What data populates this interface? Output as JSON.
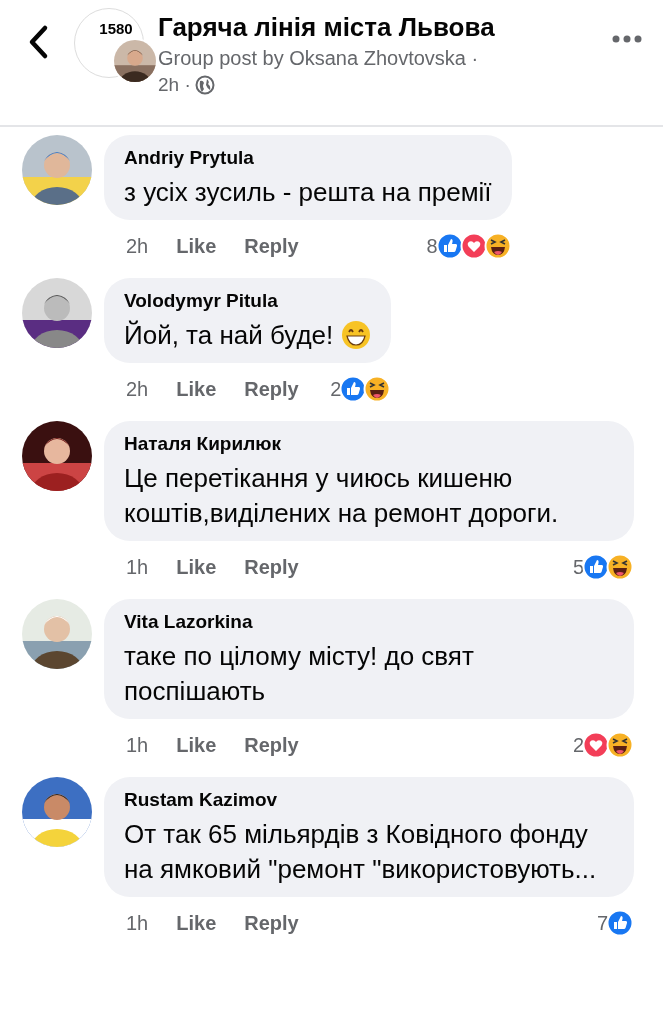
{
  "header": {
    "group_name": "Гаряча лінія міста Львова",
    "group_logo_text": "1580",
    "subtitle": "Group post by Oksana Zhovtovska ·",
    "time": "2h ·"
  },
  "comments": [
    {
      "author": "Andriy Prytula",
      "text": "з усіх зусиль - решта на премії",
      "time": "2h",
      "like": "Like",
      "reply": "Reply",
      "reaction_count": "8",
      "reactions": [
        {
          "kind": "like"
        },
        {
          "kind": "love"
        },
        {
          "kind": "haha"
        }
      ]
    },
    {
      "author": "Volodymyr Pitula",
      "text": "Йой, та най буде!",
      "trailing_emoji": true,
      "time": "2h",
      "like": "Like",
      "reply": "Reply",
      "reaction_count": "2",
      "reactions": [
        {
          "kind": "like"
        },
        {
          "kind": "haha"
        }
      ]
    },
    {
      "author": "Наталя Кирилюк",
      "text": "Це перетікання у чиюсь кишеню коштів,виділених на ремонт дороги.",
      "time": "1h",
      "like": "Like",
      "reply": "Reply",
      "reaction_count": "5",
      "reactions": [
        {
          "kind": "like"
        },
        {
          "kind": "haha"
        }
      ]
    },
    {
      "author": "Vita Lazorkina",
      "text": "таке по цілому місту! до свят поспішають",
      "time": "1h",
      "like": "Like",
      "reply": "Reply",
      "reaction_count": "2",
      "reactions": [
        {
          "kind": "love"
        },
        {
          "kind": "haha"
        }
      ]
    },
    {
      "author": "Rustam Kazimov",
      "text": "От так 65 мільярдів з Ковідного фонду на ямковий \"ремонт \"використовують...",
      "time": "1h",
      "like": "Like",
      "reply": "Reply",
      "reaction_count": "7",
      "reactions": [
        {
          "kind": "like"
        }
      ]
    }
  ]
}
